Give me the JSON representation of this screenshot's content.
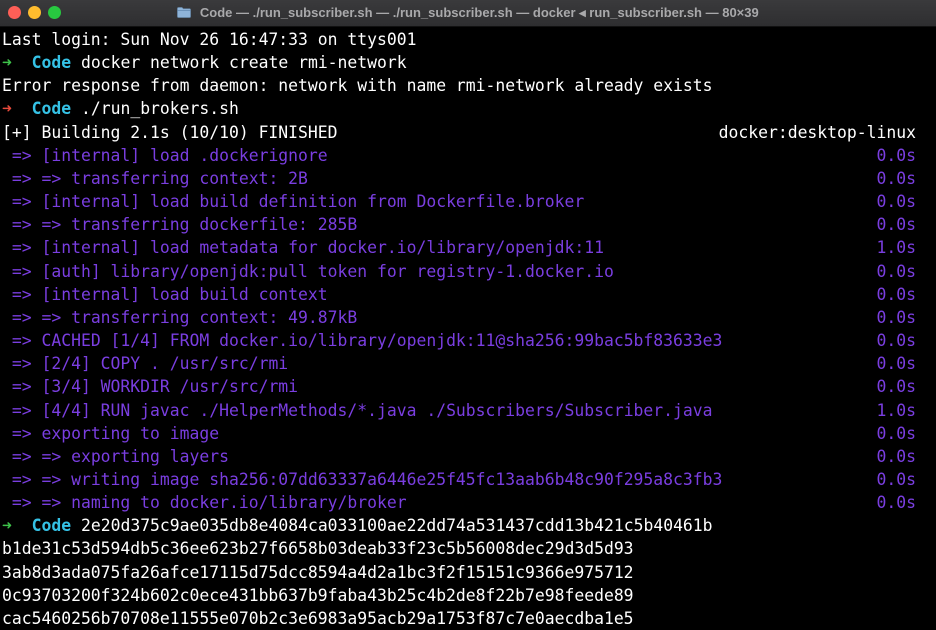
{
  "window": {
    "title": "Code — ./run_subscriber.sh — ./run_subscriber.sh — docker ◂ run_subscriber.sh — 80×39",
    "title_icon": "folder-icon",
    "colors": {
      "close": "#ff5f57",
      "minimize": "#febc2e",
      "maximize": "#28c840"
    }
  },
  "terminal": {
    "last_login": "Last login: Sun Nov 26 16:47:33 on ttys001",
    "prompt_arrow": "➜",
    "prompt_dir": "Code",
    "cmd1": "docker network create rmi-network",
    "error1": "Error response from daemon: network with name rmi-network already exists",
    "cmd2": "./run_brokers.sh",
    "build_header": "[+] Building 2.1s (10/10) FINISHED",
    "build_context": "docker:desktop-linux",
    "steps": [
      {
        "text": "=> [internal] load .dockerignore",
        "time": "0.0s"
      },
      {
        "text": "=> => transferring context: 2B",
        "time": "0.0s"
      },
      {
        "text": "=> [internal] load build definition from Dockerfile.broker",
        "time": "0.0s"
      },
      {
        "text": "=> => transferring dockerfile: 285B",
        "time": "0.0s"
      },
      {
        "text": "=> [internal] load metadata for docker.io/library/openjdk:11",
        "time": "1.0s"
      },
      {
        "text": "=> [auth] library/openjdk:pull token for registry-1.docker.io",
        "time": "0.0s"
      },
      {
        "text": "=> [internal] load build context",
        "time": "0.0s"
      },
      {
        "text": "=> => transferring context: 49.87kB",
        "time": "0.0s"
      },
      {
        "text": "=> CACHED [1/4] FROM docker.io/library/openjdk:11@sha256:99bac5bf83633e3",
        "time": "0.0s"
      },
      {
        "text": "=> [2/4] COPY . /usr/src/rmi",
        "time": "0.0s"
      },
      {
        "text": "=> [3/4] WORKDIR /usr/src/rmi",
        "time": "0.0s"
      },
      {
        "text": "=> [4/4] RUN javac ./HelperMethods/*.java ./Subscribers/Subscriber.java",
        "time": "1.0s"
      },
      {
        "text": "=> exporting to image",
        "time": "0.0s"
      },
      {
        "text": "=> => exporting layers",
        "time": "0.0s"
      },
      {
        "text": "=> => writing image sha256:07dd63337a6446e25f45fc13aab6b48c90f295a8c3fb3",
        "time": "0.0s"
      },
      {
        "text": "=> => naming to docker.io/library/broker",
        "time": "0.0s"
      }
    ],
    "cmd3": "2e20d375c9ae035db8e4084ca033100ae22dd74a531437cdd13b421c5b40461b",
    "hashes": [
      "b1de31c53d594db5c36ee623b27f6658b03deab33f23c5b56008dec29d3d5d93",
      "3ab8d3ada075fa26afce17115d75dcc8594a4d2a1bc3f2f15151c9366e975712",
      "0c93703200f324b602c0ece431bb637b9faba43b25c4b2de8f22b7e98feede89",
      "cac5460256b70708e11555e070b2c3e6983a95acb29a1753f87c7e0aecdba1e5"
    ]
  }
}
